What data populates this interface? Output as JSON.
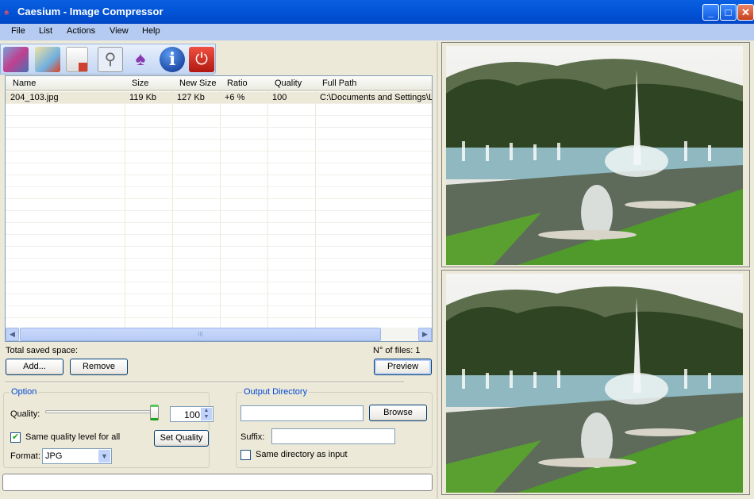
{
  "window": {
    "title": "Caesium - Image Compressor",
    "minimize": "_",
    "maximize": "□",
    "close": "✕"
  },
  "menu": [
    "File",
    "List",
    "Actions",
    "View",
    "Help"
  ],
  "toolbar": [
    {
      "icon": "open-images-icon"
    },
    {
      "icon": "remove-item-icon"
    },
    {
      "icon": "clear-list-icon"
    },
    {
      "icon": "preview-zoom-icon"
    },
    {
      "icon": "compress-caesium-icon"
    },
    {
      "icon": "info-icon"
    },
    {
      "icon": "power-exit-icon"
    }
  ],
  "list": {
    "columns": [
      "Name",
      "Size",
      "New Size",
      "Ratio",
      "Quality",
      "Full Path"
    ],
    "rows": [
      [
        "204_103.jpg",
        "119 Kb",
        "127 Kb",
        "+6 %",
        "100",
        "C:\\Documents and Settings\\L"
      ]
    ],
    "scroll_grip": "III"
  },
  "status": {
    "saved_label": "Total saved space:",
    "files_label": "N° of files: 1"
  },
  "buttons": {
    "add": "Add...",
    "remove": "Remove",
    "preview": "Preview",
    "set_quality": "Set Quality",
    "browse": "Browse"
  },
  "option": {
    "legend": "Option",
    "quality_label": "Quality:",
    "quality_value": "100",
    "quality_slider_percent": 100,
    "same_quality_label": "Same quality level for all",
    "same_quality_checked": true,
    "format_label": "Format:",
    "format_value": "JPG"
  },
  "output": {
    "legend": "Output Directory",
    "dir_value": "",
    "suffix_label": "Suffix:",
    "suffix_value": "",
    "same_dir_label": "Same directory as input",
    "same_dir_checked": false
  },
  "colors": {
    "titlebar": "#0356d8",
    "menubar": "#b5cbf1",
    "accent": "#0046d5"
  }
}
